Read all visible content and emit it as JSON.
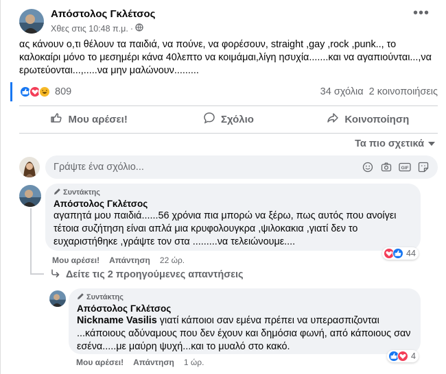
{
  "post": {
    "author": "Απόστολος Γκλέτσος",
    "time": "Χθες στις 10:48 π.μ.",
    "text": "ας κάνουν ο,τι θέλουν τα παιδιά,  να πούνε, να φορέσουν,  straight ,gay  ,rock ,punk..,  το\nκαλοκαίρι μόνο το μεσημέρι κάνα 40λεπτο να κοιμάμαι,λίγη ησυχία.......και να  αγαπιούνται...,να\nερωτεύονται...,.....να μην μαλώνουν.........",
    "reaction_count": "809",
    "comments_count": "34 σχόλια",
    "shares_count": "2 κοινοποιήσεις"
  },
  "actions": {
    "like": "Μου αρέσει!",
    "comment": "Σχόλιο",
    "share": "Κοινοποίηση"
  },
  "sort_label": "Τα πιο σχετικά",
  "comment_input": {
    "placeholder": "Γράψτε ένα σχόλιο..."
  },
  "comments": [
    {
      "badge": "Συντάκτης",
      "author": "Απόστολος Γκλέτσος",
      "text": "αγαπητά μου παιδιά......56 χρόνια πια μπορώ να ξέρω, πως αυτός που ανοίγει\nτέτοια συζήτηση είναι απλά μια κρυφολουγκρα ,ψιλοκακια ,γιατί δεν το\nευχαριστήθηκε ,γράψτε τον στα .........να τελειώνουμε....",
      "like_label": "Μου αρέσει!",
      "reply_label": "Απάντηση",
      "time": "22 ώρ.",
      "reaction_count": "44",
      "view_previous": "Δείτε τις 2 προηγούμενες απαντήσεις"
    },
    {
      "badge": "Συντάκτης",
      "author": "Απόστολος Γκλέτσος",
      "mention": "Nickname Vasilis",
      "text": " γιατί κάποιοι σαν εμένα πρέπει να υπερασπιζονται\n...κάποιους αδύναμους που δεν έχουν και δημόσια φωνή, από κάποιους σαν\nεσένα.....με μαύρη ψυχή...και το μυαλό στο κακό.",
      "like_label": "Μου αρέσει!",
      "reply_label": "Απάντηση",
      "time": "1 ώρ.",
      "reaction_count": "4"
    }
  ],
  "colors": {
    "like_blue": "#1877f2",
    "love_red": "#f33e58",
    "haha_yellow": "#f7b928",
    "secondary_text": "#65676b",
    "bubble_bg": "#f0f2f5"
  }
}
